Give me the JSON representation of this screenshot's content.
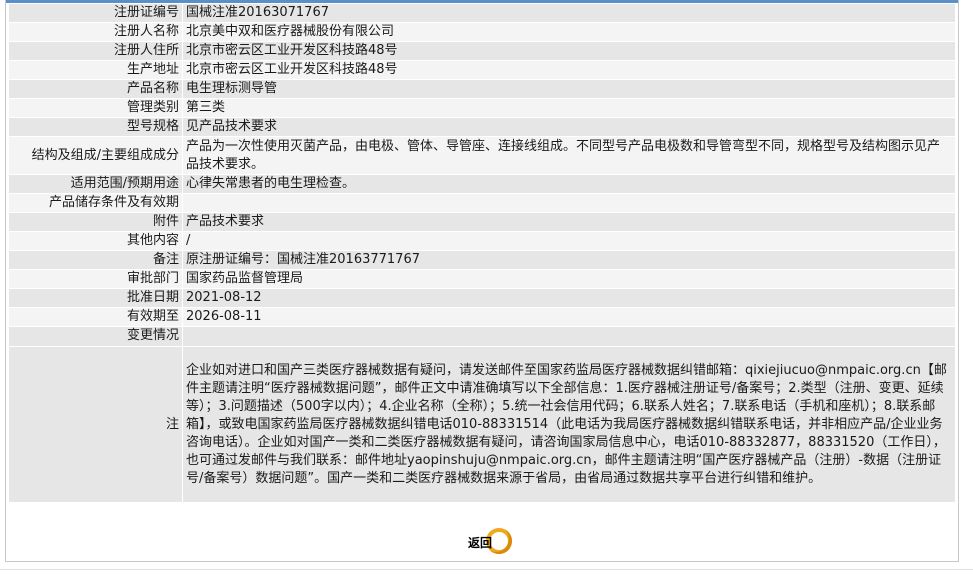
{
  "rows": [
    {
      "label": "注册证编号",
      "value": "国械注准20163071767"
    },
    {
      "label": "注册人名称",
      "value": "北京美中双和医疗器械股份有限公司"
    },
    {
      "label": "注册人住所",
      "value": "北京市密云区工业开发区科技路48号"
    },
    {
      "label": "生产地址",
      "value": "北京市密云区工业开发区科技路48号"
    },
    {
      "label": "产品名称",
      "value": "电生理标测导管"
    },
    {
      "label": "管理类别",
      "value": "第三类"
    },
    {
      "label": "型号规格",
      "value": "见产品技术要求"
    },
    {
      "label": "结构及组成/主要组成成分",
      "value": "产品为一次性使用灭菌产品，由电极、管体、导管座、连接线组成。不同型号产品电极数和导管弯型不同，规格型号及结构图示见产品技术要求。"
    },
    {
      "label": "适用范围/预期用途",
      "value": "心律失常患者的电生理检查。"
    },
    {
      "label": "产品储存条件及有效期",
      "value": ""
    },
    {
      "label": "附件",
      "value": "产品技术要求"
    },
    {
      "label": "其他内容",
      "value": "/"
    },
    {
      "label": "备注",
      "value": "原注册证编号：国械注准20163771767"
    },
    {
      "label": "审批部门",
      "value": "国家药品监督管理局"
    },
    {
      "label": "批准日期",
      "value": "2021-08-12"
    },
    {
      "label": "有效期至",
      "value": "2026-08-11"
    },
    {
      "label": "变更情况",
      "value": ""
    }
  ],
  "note": {
    "label": "注",
    "text": "企业如对进口和国产三类医疗器械数据有疑问，请发送邮件至国家药监局医疗器械数据纠错邮箱：qixiejiucuo@nmpaic.org.cn【邮件主题请注明“医疗器械数据问题”，邮件正文中请准确填写以下全部信息：1.医疗器械注册证号/备案号；2.类型（注册、变更、延续等）；3.问题描述（500字以内）；4.企业名称（全称）；5.统一社会信用代码；6.联系人姓名；7.联系电话（手机和座机）；8.联系邮箱】，或致电国家药监局医疗器械数据纠错电话010-88331514（此电话为我局医疗器械数据纠错联系电话，并非相应产品/企业业务咨询电话）。企业如对国产一类和二类医疗器械数据有疑问，请咨询国家局信息中心，电话010-88332877，88331520（工作日），也可通过发邮件与我们联系：邮件地址yaopinshuju@nmpaic.org.cn，邮件主题请注明“国产医疗器械产品（注册）-数据（注册证号/备案号）数据问题”。国产一类和二类医疗器械数据来源于省局，由省局通过数据共享平台进行纠错和维护。"
  },
  "back_button": {
    "label": "返回"
  },
  "colors": {
    "accent": "#5b8fc7",
    "row_dark": "#e6e6e6",
    "row_light": "#f4f4f4",
    "button": "#f0a81c"
  }
}
